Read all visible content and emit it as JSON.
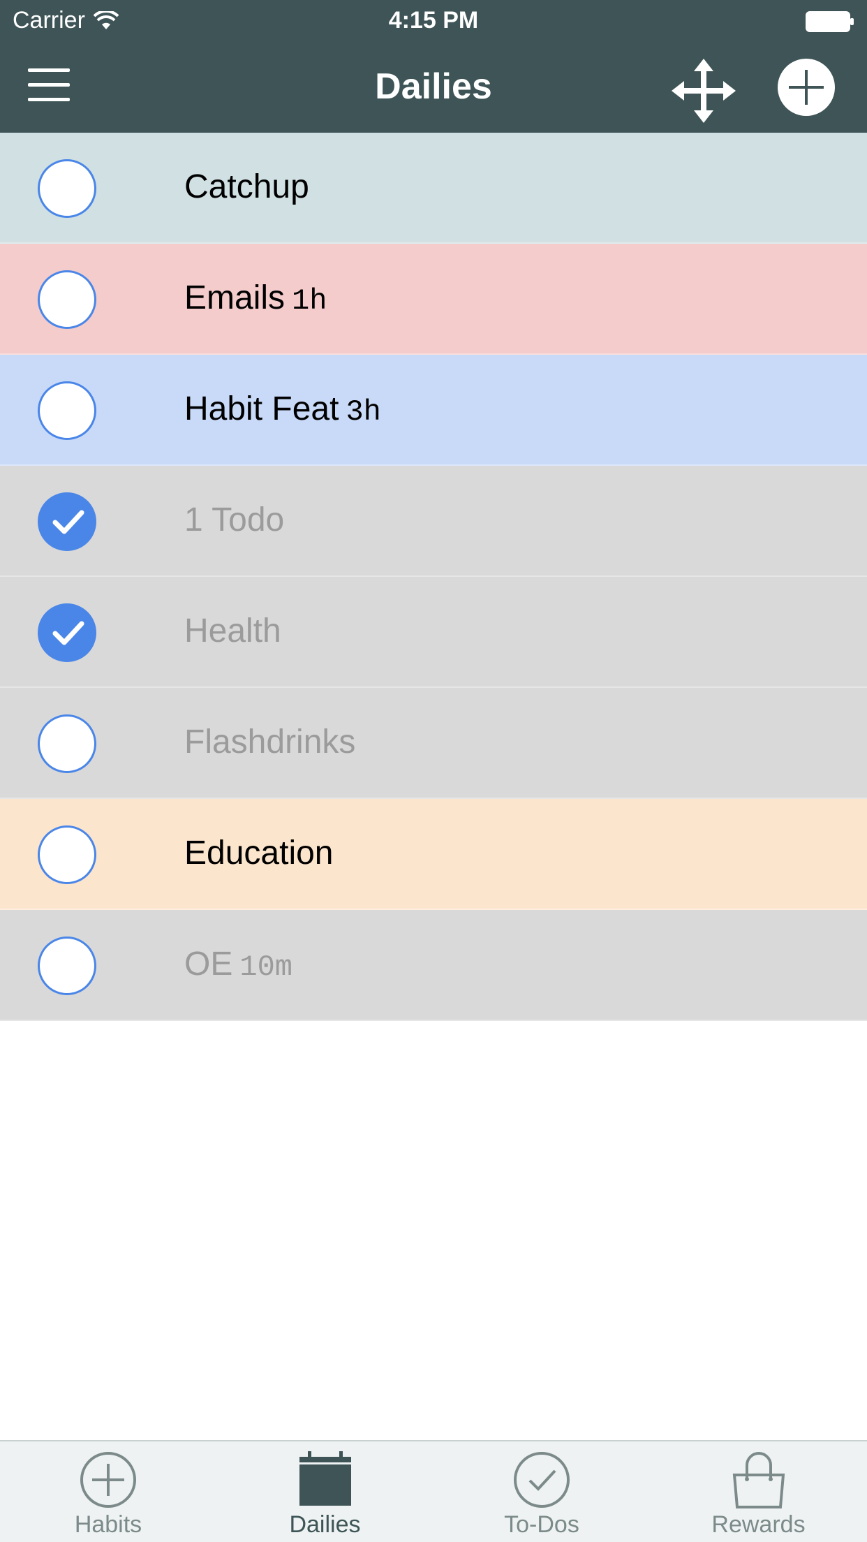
{
  "status_bar": {
    "carrier": "Carrier",
    "time": "4:15 PM"
  },
  "nav": {
    "title": "Dailies"
  },
  "tasks": [
    {
      "label": "Catchup",
      "duration": "",
      "checked": false,
      "color": "#d0e0e3"
    },
    {
      "label": "Emails",
      "duration": "1h",
      "checked": false,
      "color": "#f4cccc"
    },
    {
      "label": "Habit Feat",
      "duration": "3h",
      "checked": false,
      "color": "#c9daf8"
    },
    {
      "label": "1 Todo",
      "duration": "",
      "checked": true,
      "color": "#d9d9d9"
    },
    {
      "label": "Health",
      "duration": "",
      "checked": true,
      "color": "#d9d9d9"
    },
    {
      "label": "Flashdrinks",
      "duration": "",
      "checked": false,
      "color": "#d9d9d9"
    },
    {
      "label": "Education",
      "duration": "",
      "checked": false,
      "color": "#fce5cd"
    },
    {
      "label": "OE",
      "duration": "10m",
      "checked": false,
      "color": "#d9d9d9"
    }
  ],
  "tab_bar": {
    "tabs": [
      {
        "label": "Habits",
        "icon": "plus-circle-icon",
        "active": false
      },
      {
        "label": "Dailies",
        "icon": "calendar-icon",
        "active": true
      },
      {
        "label": "To-Dos",
        "icon": "check-circle-icon",
        "active": false
      },
      {
        "label": "Rewards",
        "icon": "shopping-bag-icon",
        "active": false
      }
    ]
  },
  "colors": {
    "header": "#3e5456",
    "accent": "#4a86e8",
    "tab_active": "#3e5456",
    "tab_inactive": "#7c8a8a"
  }
}
